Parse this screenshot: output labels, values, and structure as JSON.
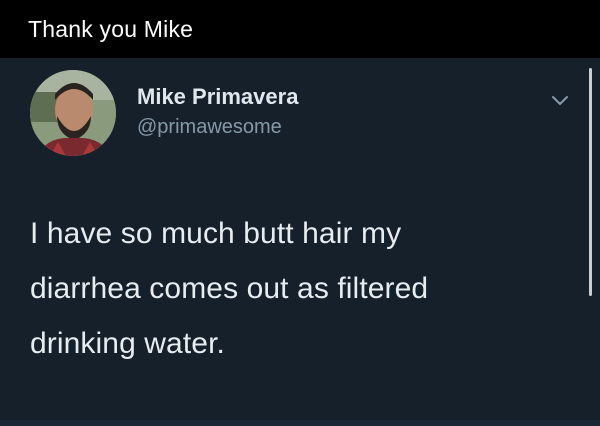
{
  "caption": {
    "text": "Thank you Mike"
  },
  "tweet": {
    "author": {
      "display_name": "Mike Primavera",
      "handle": "@primawesome"
    },
    "body_lines": [
      "I have so much butt hair my",
      "diarrhea comes out as filtered",
      "drinking water."
    ],
    "menu_icon": "chevron-down-icon"
  },
  "colors": {
    "background": "#15202b",
    "caption_bar": "#000000",
    "name_text": "#e1e8ed",
    "handle_text": "#8899a6",
    "body_text": "#e6ecf0"
  }
}
